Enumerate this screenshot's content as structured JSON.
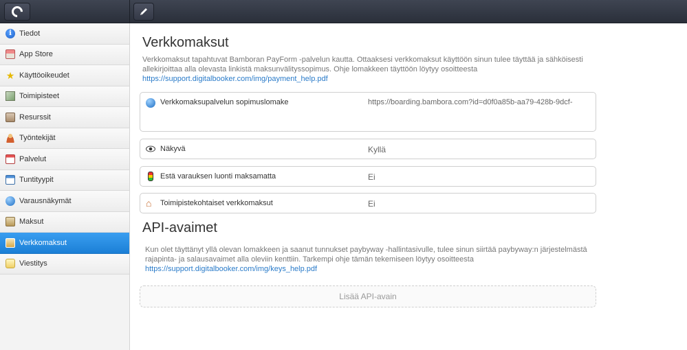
{
  "sidebar": {
    "items": [
      {
        "label": "Tiedot",
        "icon": "info-icon"
      },
      {
        "label": "App Store",
        "icon": "store-icon"
      },
      {
        "label": "Käyttöoikeudet",
        "icon": "star-icon"
      },
      {
        "label": "Toimipisteet",
        "icon": "location-photo-icon"
      },
      {
        "label": "Resurssit",
        "icon": "resource-icon"
      },
      {
        "label": "Työntekijät",
        "icon": "user-icon"
      },
      {
        "label": "Palvelut",
        "icon": "calendar-icon"
      },
      {
        "label": "Tuntityypit",
        "icon": "calendar-hours-icon"
      },
      {
        "label": "Varausnäkymät",
        "icon": "globe-icon"
      },
      {
        "label": "Maksut",
        "icon": "payment-icon"
      },
      {
        "label": "Verkkomaksut",
        "icon": "web-payment-icon",
        "active": true
      },
      {
        "label": "Viestitys",
        "icon": "message-icon"
      }
    ]
  },
  "main": {
    "title": "Verkkomaksut",
    "description": "Verkkomaksut tapahtuvat Bamboran PayForm -palvelun kautta. Ottaaksesi verkkomaksut käyttöön sinun tulee täyttää ja sähköisesti allekirjoittaa alla olevasta linkistä maksunvälityssopimus. Ohje lomakkeen täyttöön löytyy osoitteesta",
    "help_link": "https://support.digitalbooker.com/img/payment_help.pdf",
    "rows": [
      {
        "label": "Verkkomaksupalvelun sopimuslomake",
        "value": "https://boarding.bambora.com?id=d0f0a85b-aa79-428b-9dcf-",
        "icon": "globe-icon"
      },
      {
        "label": "Näkyvä",
        "value": "Kyllä",
        "icon": "eye-icon"
      },
      {
        "label": "Estä varauksen luonti maksamatta",
        "value": "Ei",
        "icon": "traffic-light-icon"
      },
      {
        "label": "Toimipistekohtaiset verkkomaksut",
        "value": "Ei",
        "icon": "house-icon"
      }
    ]
  },
  "api": {
    "title": "API-avaimet",
    "description": "Kun olet täyttänyt yllä olevan lomakkeen ja saanut tunnukset paybyway -hallintasivulle, tulee sinun siirtää paybyway:n järjestelmästä rajapinta- ja salausavaimet alla oleviin kenttiin. Tarkempi ohje tämän tekemiseen löytyy osoitteesta",
    "help_link": "https://support.digitalbooker.com/img/keys_help.pdf",
    "add_button": "Lisää API-avain"
  },
  "colors": {
    "accent": "#1b7fd6",
    "topbar": "#2a2f3a",
    "link": "#2a7bc9"
  }
}
